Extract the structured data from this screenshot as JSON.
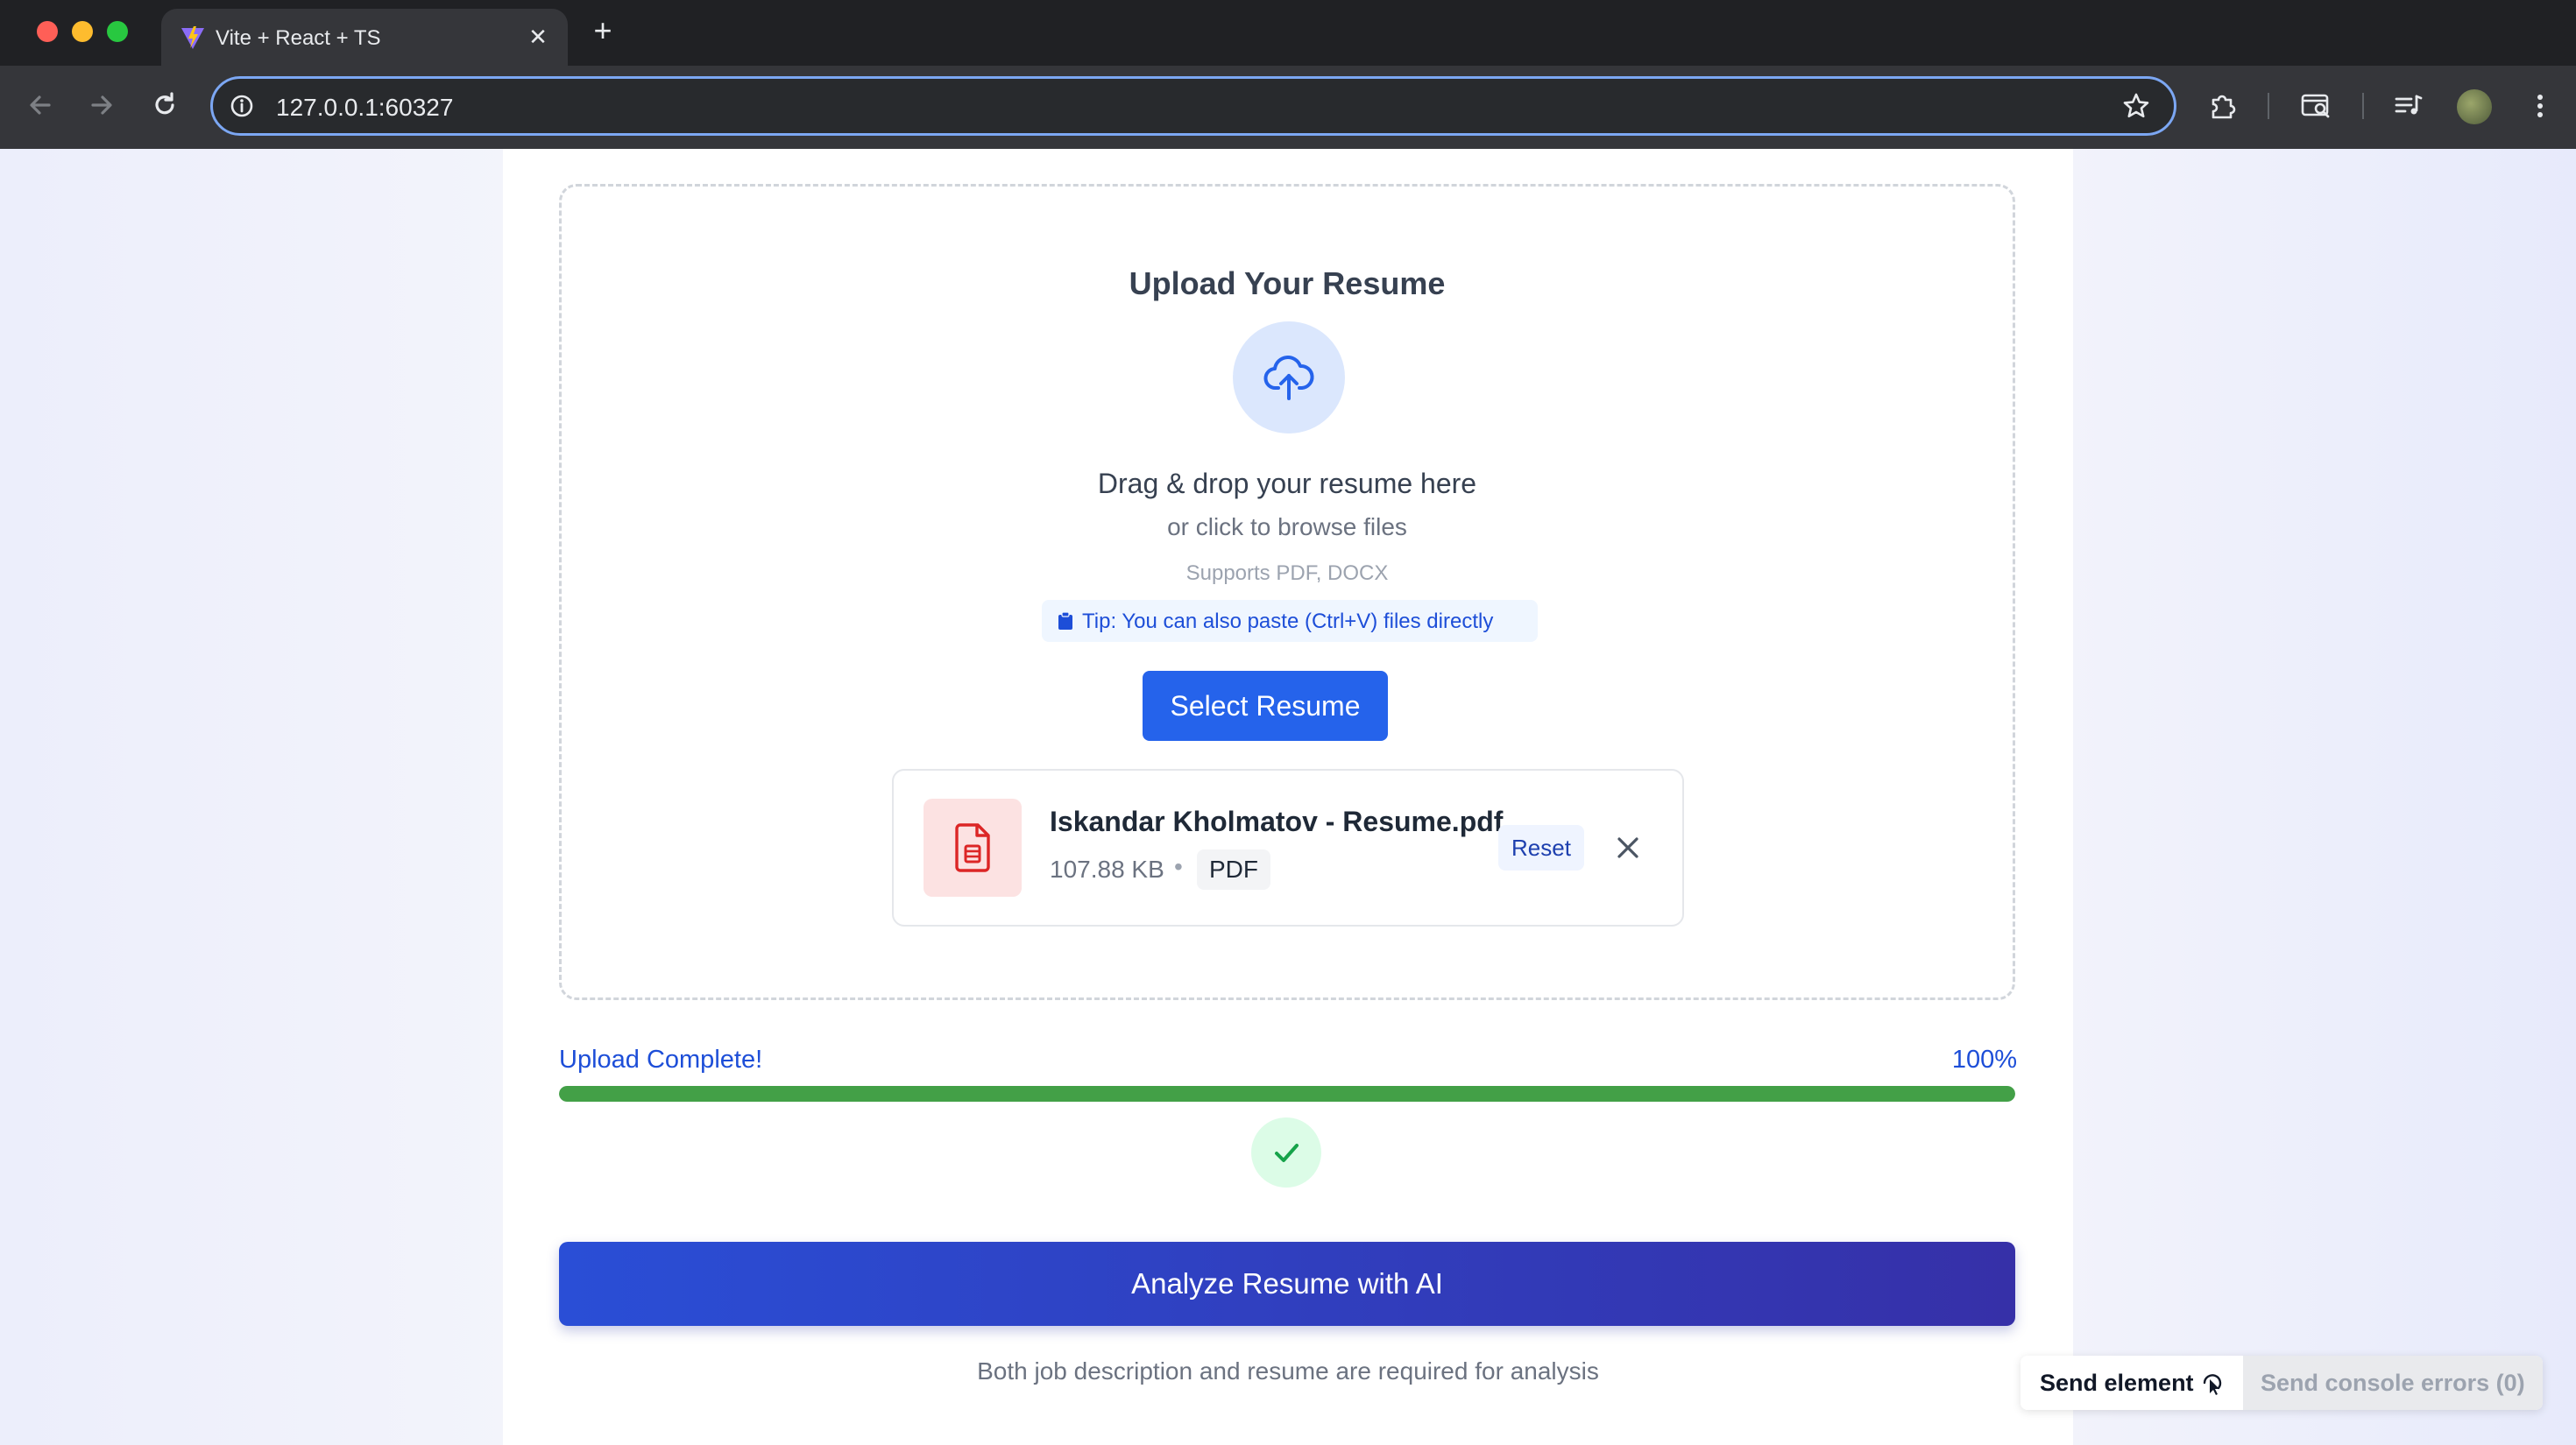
{
  "browser": {
    "tab_title": "Vite + React + TS",
    "url": "127.0.0.1:60327",
    "new_tab_symbol": "+",
    "close_symbol": "✕"
  },
  "upload": {
    "title": "Upload Your Resume",
    "drag_text": "Drag & drop your resume here",
    "browse_text": "or click to browse files",
    "supported": "Supports PDF, DOCX",
    "tip": "Tip: You can also paste (Ctrl+V) files directly",
    "select_button": "Select Resume"
  },
  "file": {
    "name": "Iskandar Kholmatov - Resume.pdf",
    "size": "107.88 KB",
    "separator": "•",
    "type": "PDF",
    "reset_label": "Reset"
  },
  "progress": {
    "status": "Upload Complete!",
    "percent_label": "100%",
    "percent": 100
  },
  "actions": {
    "analyze_button": "Analyze Resume with AI",
    "footnote": "Both job description and resume are required for analysis"
  },
  "toolbar": {
    "send_element": "Send element",
    "send_console": "Send console errors (0)"
  },
  "colors": {
    "primary": "#2563eb",
    "success": "#43a047",
    "analyze_gradient_start": "#2a4ed6",
    "analyze_gradient_end": "#3630a8"
  }
}
